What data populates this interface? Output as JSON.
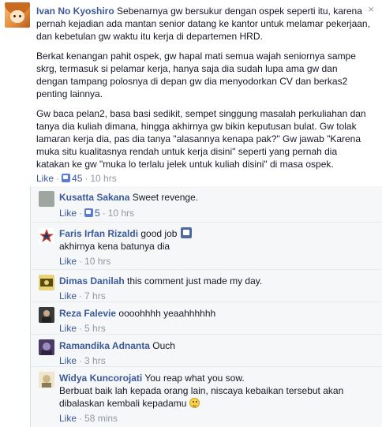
{
  "main": {
    "author": "Ivan No Kyoshiro",
    "para1": "Sebenarnya gw bersukur dengan ospek seperti itu, karena pernah kejadian ada mantan senior datang ke kantor untuk melamar pekerjaan, dan kebetulan gw waktu itu kerja di departemen HRD.",
    "para2": "Berkat kenangan pahit ospek, gw hapal mati semua wajah seniornya sampe skrg, termasuk si pelamar kerja, hanya saja dia sudah lupa ama gw dan dengan tampang polosnya di depan gw dia menyodorkan CV dan berkas2 penting lainnya.",
    "para3": "Gw baca pelan2, basa basi sedikit, sempet singgung masalah perkuliahan dan tanya dia kuliah dimana, hingga akhirnya gw bikin keputusan bulat. Gw tolak lamaran kerja dia, pas dia tanya \"alasannya kenapa pak?\" Gw jawab \"Karena muka situ kualitasnya rendah untuk kerja disini\" seperti yang pernah dia katakan ke gw \"muka lo terlalu jelek untuk kuliah disini\" di masa ospek.",
    "like_label": "Like",
    "like_count": "45",
    "time": "10 hrs",
    "close_icon": "×"
  },
  "replies": [
    {
      "author": "Kusatta Sakana",
      "text": "Sweet revenge.",
      "like_label": "Like",
      "like_count": "5",
      "time": "10 hrs",
      "avatar_color": "#9fa6a0"
    },
    {
      "author": "Faris Irfan Rizaldi",
      "text": "good job",
      "text2": "akhirnya kena batunya dia",
      "like_label": "Like",
      "time": "10 hrs",
      "avatar_color": "#c0392b"
    },
    {
      "author": "Dimas Danilah",
      "text": "this comment just made my day.",
      "like_label": "Like",
      "time": "7 hrs",
      "avatar_color": "#c8a83a"
    },
    {
      "author": "Reza Falevie",
      "text": "oooohhhh yeaahhhhhh",
      "like_label": "Like",
      "time": "5 hrs",
      "avatar_color": "#5a5a5a"
    },
    {
      "author": "Ramandika Adnanta",
      "text": "Ouch",
      "like_label": "Like",
      "time": "3 hrs",
      "avatar_color": "#6b5a8a"
    },
    {
      "author": "Widya Kuncorojati",
      "text": "You reap what you sow.",
      "text2": "Berbuat baik lah kepada orang lain, niscaya kebaikan tersebut akan dibalaskan kembali kepadamu",
      "like_label": "Like",
      "time": "58 mins",
      "avatar_color": "#d9c9a0"
    }
  ],
  "colors": {
    "link": "#3b5998",
    "meta": "#9197a3",
    "reply_bg": "#f6f7f9"
  }
}
